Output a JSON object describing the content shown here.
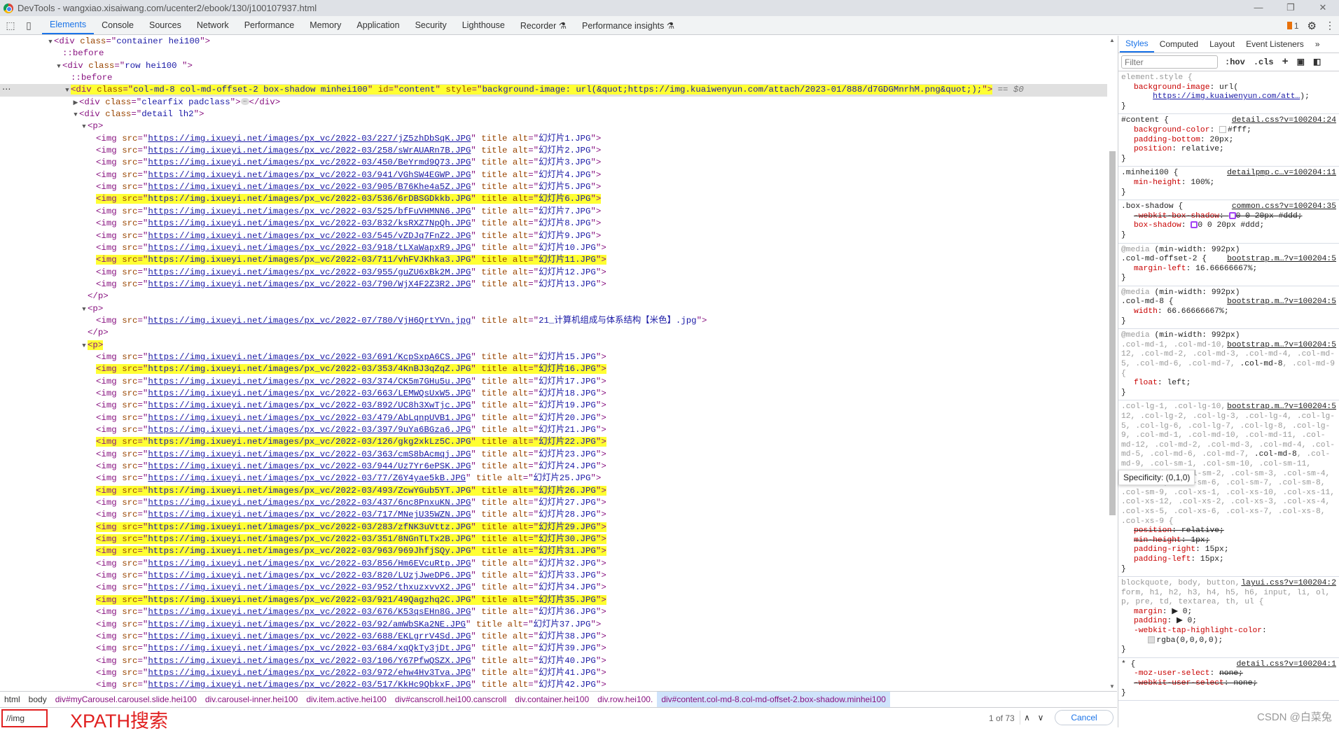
{
  "window": {
    "title": "DevTools - wangxiao.xisaiwang.com/ucenter2/ebook/130/j100107937.html",
    "controls": [
      "—",
      "❐",
      "✕"
    ]
  },
  "toolbar": {
    "tabs": [
      "Elements",
      "Console",
      "Sources",
      "Network",
      "Performance",
      "Memory",
      "Application",
      "Security",
      "Lighthouse",
      "Recorder ⚗",
      "Performance insights ⚗"
    ],
    "active_tab": "Elements",
    "issues_count": "1"
  },
  "tokens": {
    "img_open": "<img ",
    "src_attr": "src",
    "eq_quote": "=\"",
    "close_quote": "\"",
    "title_attr": " title",
    "alt_attr": " alt",
    "gt": ">"
  },
  "dom_rows": [
    {
      "depth": 0,
      "arrow": "▼",
      "parts": [
        [
          "tag",
          "<div "
        ],
        [
          "an",
          "class"
        ],
        [
          "tag",
          "=\""
        ],
        [
          "av",
          "container hei100"
        ],
        [
          "tag",
          "\">"
        ]
      ]
    },
    {
      "depth": 1,
      "arrow": "",
      "parts": [
        [
          "pseudo",
          "::before"
        ]
      ]
    },
    {
      "depth": 1,
      "arrow": "▼",
      "parts": [
        [
          "tag",
          "<div "
        ],
        [
          "an",
          "class"
        ],
        [
          "tag",
          "=\""
        ],
        [
          "av",
          "row hei100 "
        ],
        [
          "tag",
          "\">"
        ]
      ]
    },
    {
      "depth": 2,
      "arrow": "",
      "parts": [
        [
          "pseudo",
          "::before"
        ]
      ]
    },
    {
      "depth": 2,
      "arrow": "▼",
      "selected": true,
      "highlight": true,
      "parts": [
        [
          "tag",
          "<div "
        ],
        [
          "an",
          "class"
        ],
        [
          "tag",
          "=\""
        ],
        [
          "av",
          "col-md-8 col-md-offset-2 box-shadow minhei100"
        ],
        [
          "tag",
          "\" "
        ],
        [
          "an",
          "id"
        ],
        [
          "tag",
          "=\""
        ],
        [
          "av",
          "content"
        ],
        [
          "tag",
          "\" "
        ],
        [
          "an",
          "style"
        ],
        [
          "tag",
          "=\""
        ],
        [
          "av",
          "background-image: url(&quot;https://img.kuaiwenyun.com/attach/2023-01/888/d7GDGMnrhM.png&quot;);"
        ],
        [
          "tag",
          "\">"
        ]
      ],
      "suffix": " == $0"
    },
    {
      "depth": 3,
      "arrow": "▶",
      "parts": [
        [
          "tag",
          "<div "
        ],
        [
          "an",
          "class"
        ],
        [
          "tag",
          "=\""
        ],
        [
          "av",
          "clearfix padclass"
        ],
        [
          "tag",
          "\">"
        ],
        [
          "ell",
          "…"
        ],
        [
          "tag",
          "</div>"
        ]
      ]
    },
    {
      "depth": 3,
      "arrow": "▼",
      "parts": [
        [
          "tag",
          "<div "
        ],
        [
          "an",
          "class"
        ],
        [
          "tag",
          "=\""
        ],
        [
          "av",
          "detail lh2"
        ],
        [
          "tag",
          "\">"
        ]
      ]
    }
  ],
  "paragraphs": [
    {
      "open": "<p>",
      "close": "</p>",
      "open_highlight": false,
      "images": [
        {
          "src": "https://img.ixueyi.net/images/px_vc/2022-03/227/jZ5zhDbSqK.JPG",
          "alt": "幻灯片1.JPG"
        },
        {
          "src": "https://img.ixueyi.net/images/px_vc/2022-03/258/sWrAUARn7B.JPG",
          "alt": "幻灯片2.JPG"
        },
        {
          "src": "https://img.ixueyi.net/images/px_vc/2022-03/450/BeYrmd9Q73.JPG",
          "alt": "幻灯片3.JPG"
        },
        {
          "src": "https://img.ixueyi.net/images/px_vc/2022-03/941/VGhSW4EGWP.JPG",
          "alt": "幻灯片4.JPG"
        },
        {
          "src": "https://img.ixueyi.net/images/px_vc/2022-03/905/B76Khe4a5Z.JPG",
          "alt": "幻灯片5.JPG"
        },
        {
          "src": "https://img.ixueyi.net/images/px_vc/2022-03/536/6rDBSGDkkb.JPG",
          "alt": "幻灯片6.JPG",
          "match": true
        },
        {
          "src": "https://img.ixueyi.net/images/px_vc/2022-03/525/bfFuVHMNN6.JPG",
          "alt": "幻灯片7.JPG"
        },
        {
          "src": "https://img.ixueyi.net/images/px_vc/2022-03/832/ksRXZ7NpQh.JPG",
          "alt": "幻灯片8.JPG"
        },
        {
          "src": "https://img.ixueyi.net/images/px_vc/2022-03/545/vZDJq7FnZ2.JPG",
          "alt": "幻灯片9.JPG"
        },
        {
          "src": "https://img.ixueyi.net/images/px_vc/2022-03/918/tLXaWapxR9.JPG",
          "alt": "幻灯片10.JPG"
        },
        {
          "src": "https://img.ixueyi.net/images/px_vc/2022-03/711/vhFVJKhka3.JPG",
          "alt": "幻灯片11.JPG",
          "match": true
        },
        {
          "src": "https://img.ixueyi.net/images/px_vc/2022-03/955/guZU6xBk2M.JPG",
          "alt": "幻灯片12.JPG"
        },
        {
          "src": "https://img.ixueyi.net/images/px_vc/2022-03/790/WjX4F2Z3R2.JPG",
          "alt": "幻灯片13.JPG"
        }
      ]
    },
    {
      "open": "<p>",
      "close": "</p>",
      "open_highlight": false,
      "images": [
        {
          "src": "https://img.ixueyi.net/images/px_vc/2022-07/780/VjH6QrtYVn.jpg",
          "alt": "21_计算机组成与体系结构【米色】.jpg"
        }
      ]
    },
    {
      "open": "<p>",
      "close": null,
      "open_highlight": true,
      "images": [
        {
          "src": "https://img.ixueyi.net/images/px_vc/2022-03/691/KcpSxpA6CS.JPG",
          "alt": "幻灯片15.JPG"
        },
        {
          "src": "https://img.ixueyi.net/images/px_vc/2022-03/353/4KnBJ3qZqZ.JPG",
          "alt": "幻灯片16.JPG",
          "match": true
        },
        {
          "src": "https://img.ixueyi.net/images/px_vc/2022-03/374/CK5m7GHu5u.JPG",
          "alt": "幻灯片17.JPG"
        },
        {
          "src": "https://img.ixueyi.net/images/px_vc/2022-03/663/LEMWQsUxW5.JPG",
          "alt": "幻灯片18.JPG"
        },
        {
          "src": "https://img.ixueyi.net/images/px_vc/2022-03/892/UC8h3XwTjc.JPG",
          "alt": "幻灯片19.JPG"
        },
        {
          "src": "https://img.ixueyi.net/images/px_vc/2022-03/479/AbLqnpUVB1.JPG",
          "alt": "幻灯片20.JPG"
        },
        {
          "src": "https://img.ixueyi.net/images/px_vc/2022-03/397/9uYa6BGza6.JPG",
          "alt": "幻灯片21.JPG"
        },
        {
          "src": "https://img.ixueyi.net/images/px_vc/2022-03/126/gkg2xkLz5C.JPG",
          "alt": "幻灯片22.JPG",
          "match": true
        },
        {
          "src": "https://img.ixueyi.net/images/px_vc/2022-03/363/cmS8bAcmqj.JPG",
          "alt": "幻灯片23.JPG"
        },
        {
          "src": "https://img.ixueyi.net/images/px_vc/2022-03/944/Uz7Yr6ePSK.JPG",
          "alt": "幻灯片24.JPG"
        },
        {
          "src": "https://img.ixueyi.net/images/px_vc/2022-03/77/Z6Y4yae5kB.JPG",
          "alt": "幻灯片25.JPG"
        },
        {
          "src": "https://img.ixueyi.net/images/px_vc/2022-03/493/ZcwYGub5YT.JPG",
          "alt": "幻灯片26.JPG",
          "match": true
        },
        {
          "src": "https://img.ixueyi.net/images/px_vc/2022-03/437/6nc8PnxuKN.JPG",
          "alt": "幻灯片27.JPG"
        },
        {
          "src": "https://img.ixueyi.net/images/px_vc/2022-03/717/MNejU35WZN.JPG",
          "alt": "幻灯片28.JPG"
        },
        {
          "src": "https://img.ixueyi.net/images/px_vc/2022-03/283/zfNK3uVttz.JPG",
          "alt": "幻灯片29.JPG",
          "match": true
        },
        {
          "src": "https://img.ixueyi.net/images/px_vc/2022-03/351/8NGnTLTx2B.JPG",
          "alt": "幻灯片30.JPG",
          "match": true
        },
        {
          "src": "https://img.ixueyi.net/images/px_vc/2022-03/963/969JhfjSQy.JPG",
          "alt": "幻灯片31.JPG",
          "match": true
        },
        {
          "src": "https://img.ixueyi.net/images/px_vc/2022-03/856/Hm6EVcuRtp.JPG",
          "alt": "幻灯片32.JPG"
        },
        {
          "src": "https://img.ixueyi.net/images/px_vc/2022-03/820/LUzjJweDP6.JPG",
          "alt": "幻灯片33.JPG"
        },
        {
          "src": "https://img.ixueyi.net/images/px_vc/2022-03/952/thxuzxvvX2.JPG",
          "alt": "幻灯片34.JPG"
        },
        {
          "src": "https://img.ixueyi.net/images/px_vc/2022-03/921/49Qagzhq2C.JPG",
          "alt": "幻灯片35.JPG",
          "match": true
        },
        {
          "src": "https://img.ixueyi.net/images/px_vc/2022-03/676/K53qsEHn8G.JPG",
          "alt": "幻灯片36.JPG"
        },
        {
          "src": "https://img.ixueyi.net/images/px_vc/2022-03/92/amWbSKa2NE.JPG",
          "alt": "幻灯片37.JPG"
        },
        {
          "src": "https://img.ixueyi.net/images/px_vc/2022-03/688/EKLgrrV4Sd.JPG",
          "alt": "幻灯片38.JPG"
        },
        {
          "src": "https://img.ixueyi.net/images/px_vc/2022-03/684/xqQkTy3jDt.JPG",
          "alt": "幻灯片39.JPG"
        },
        {
          "src": "https://img.ixueyi.net/images/px_vc/2022-03/106/Y67PfwQSZX.JPG",
          "alt": "幻灯片40.JPG"
        },
        {
          "src": "https://img.ixueyi.net/images/px_vc/2022-03/972/ehw4Hv3Tva.JPG",
          "alt": "幻灯片41.JPG"
        },
        {
          "src": "https://img.ixueyi.net/images/px_vc/2022-03/517/KkHc9QbkxF.JPG",
          "alt": "幻灯片42.JPG"
        }
      ]
    }
  ],
  "styles_pane": {
    "tabs": [
      "Styles",
      "Computed",
      "Layout",
      "Event Listeners",
      "»"
    ],
    "active_tab": "Styles",
    "filter_placeholder": "Filter",
    "hov": ":hov",
    "cls": ".cls",
    "rules": [
      {
        "selector_plain": "element.style {",
        "props": [
          {
            "n": "background-image",
            "v": "url(",
            "link": "https://img.kuaiwenyun.com/att…",
            "after": ");"
          }
        ]
      },
      {
        "selector": "#content {",
        "source": "detail.css?v=100204:24",
        "props": [
          {
            "n": "background-color",
            "v": "#fff;",
            "swatch": "#ffffff"
          },
          {
            "n": "padding-bottom",
            "v": "20px;"
          },
          {
            "n": "position",
            "v": "relative;"
          }
        ]
      },
      {
        "selector": ".minhei100 {",
        "source": "detailpmp.c…v=100204:11",
        "props": [
          {
            "n": "min-height",
            "v": "100%;"
          }
        ]
      },
      {
        "selector": ".box-shadow {",
        "source": "common.css?v=100204:35",
        "props": [
          {
            "n": "-webkit-box-shadow",
            "v": "0 0 20px #ddd;",
            "struck": true,
            "shadow": true
          },
          {
            "n": "box-shadow",
            "v": "0 0 20px #ddd;",
            "shadow": true
          }
        ]
      },
      {
        "media": "@media",
        "media_q": "(min-width: 992px)",
        "selector": ".col-md-offset-2 {",
        "source": "bootstrap.m…?v=100204:5",
        "props": [
          {
            "n": "margin-left",
            "v": "16.66666667%;"
          }
        ]
      },
      {
        "media": "@media",
        "media_q": "(min-width: 992px)",
        "selector": ".col-md-8 {",
        "source": "bootstrap.m…?v=100204:5",
        "props": [
          {
            "n": "width",
            "v": "66.66666667%;"
          }
        ]
      },
      {
        "media": "@media",
        "media_q": "(min-width: 992px)",
        "selector_long": ".col-md-1, .col-md-10, .col-md-11, .col-md-12, .col-md-2, .col-md-3, .col-md-4, .col-md-5, .col-md-6, .col-md-7, ",
        "selector_match": ".col-md-8",
        "selector_rest": ", .col-md-9 {",
        "source": "bootstrap.m…?v=100204:5",
        "props": [
          {
            "n": "float",
            "v": "left;"
          }
        ]
      },
      {
        "selector_long": ".col-lg-1, .col-lg-10, .col-lg-11, .col-lg-12, .col-lg-2, .col-lg-3, .col-lg-4, .col-lg-5, .col-lg-6, .col-lg-7, .col-lg-8, .col-lg-9, .col-md-1, .col-md-10, .col-md-11, .col-md-12, .col-md-2, .col-md-3, .col-md-4, .col-md-5, .col-md-6, .col-md-7, ",
        "selector_match": ".col-md-8",
        "selector_rest": ", .col-md-9, .col-sm-1, .col-sm-10, .col-sm-11, .col-sm-12, .col-sm-2, .col-sm-3, .col-sm-4, .col-sm-5, .col-sm-6, .col-sm-7, .col-sm-8, .col-sm-9, .col-xs-1, .col-xs-10, .col-xs-11, .col-xs-12, .col-xs-2, .col-xs-3, .col-xs-4, .col-xs-5, .col-xs-6, .col-xs-7, .col-xs-8, .col-xs-9 {",
        "source": "bootstrap.m…?v=100204:5",
        "props": [
          {
            "n": "position",
            "v": "relative;",
            "struck": true
          },
          {
            "n": "min-height",
            "v": "1px;",
            "struck": true
          },
          {
            "n": "padding-right",
            "v": "15px;"
          },
          {
            "n": "padding-left",
            "v": "15px;"
          }
        ]
      },
      {
        "selector_long": "blockquote, body, button, dd, ",
        "selector_match": "div",
        "selector_rest": ", dl, dt, form, h1, h2, h3, h4, h5, h6, input, li, ol, p, pre, td, textarea, th, ul {",
        "source": "layui.css?v=100204:2",
        "props": [
          {
            "n": "margin",
            "v": "▶ 0;"
          },
          {
            "n": "padding",
            "v": "▶ 0;"
          },
          {
            "n": "-webkit-tap-highlight-color",
            "v": "rgba(0,0,0,0);",
            "swatch": "#dddddd",
            "wrap": true
          }
        ]
      },
      {
        "selector": "* {",
        "source": "detail.css?v=100204:1",
        "props": [
          {
            "n": "-moz-user-select",
            "v": "none;",
            "struck_val": true
          },
          {
            "n": "-webkit-user-select",
            "v": "none;",
            "struck": true
          }
        ]
      }
    ],
    "tooltip": "Specificity: (0,1,0)"
  },
  "breadcrumbs": [
    "html",
    "body",
    "div#myCarousel.carousel.slide.hei100",
    "div.carousel-inner.hei100",
    "div.item.active.hei100",
    "div#canscroll.hei100.canscroll",
    "div.container.hei100",
    "div.row.hei100.",
    "div#content.col-md-8.col-md-offset-2.box-shadow.minhei100"
  ],
  "search": {
    "value": "//img",
    "annotation": "XPATH搜索",
    "match_count": "1 of 73",
    "prev": "∧",
    "next": "∨",
    "cancel": "Cancel"
  },
  "watermark": "CSDN @白菜兔",
  "colors": {
    "highlight": "#ffff33",
    "accent": "#1a73e8",
    "annotation": "#e02020"
  }
}
